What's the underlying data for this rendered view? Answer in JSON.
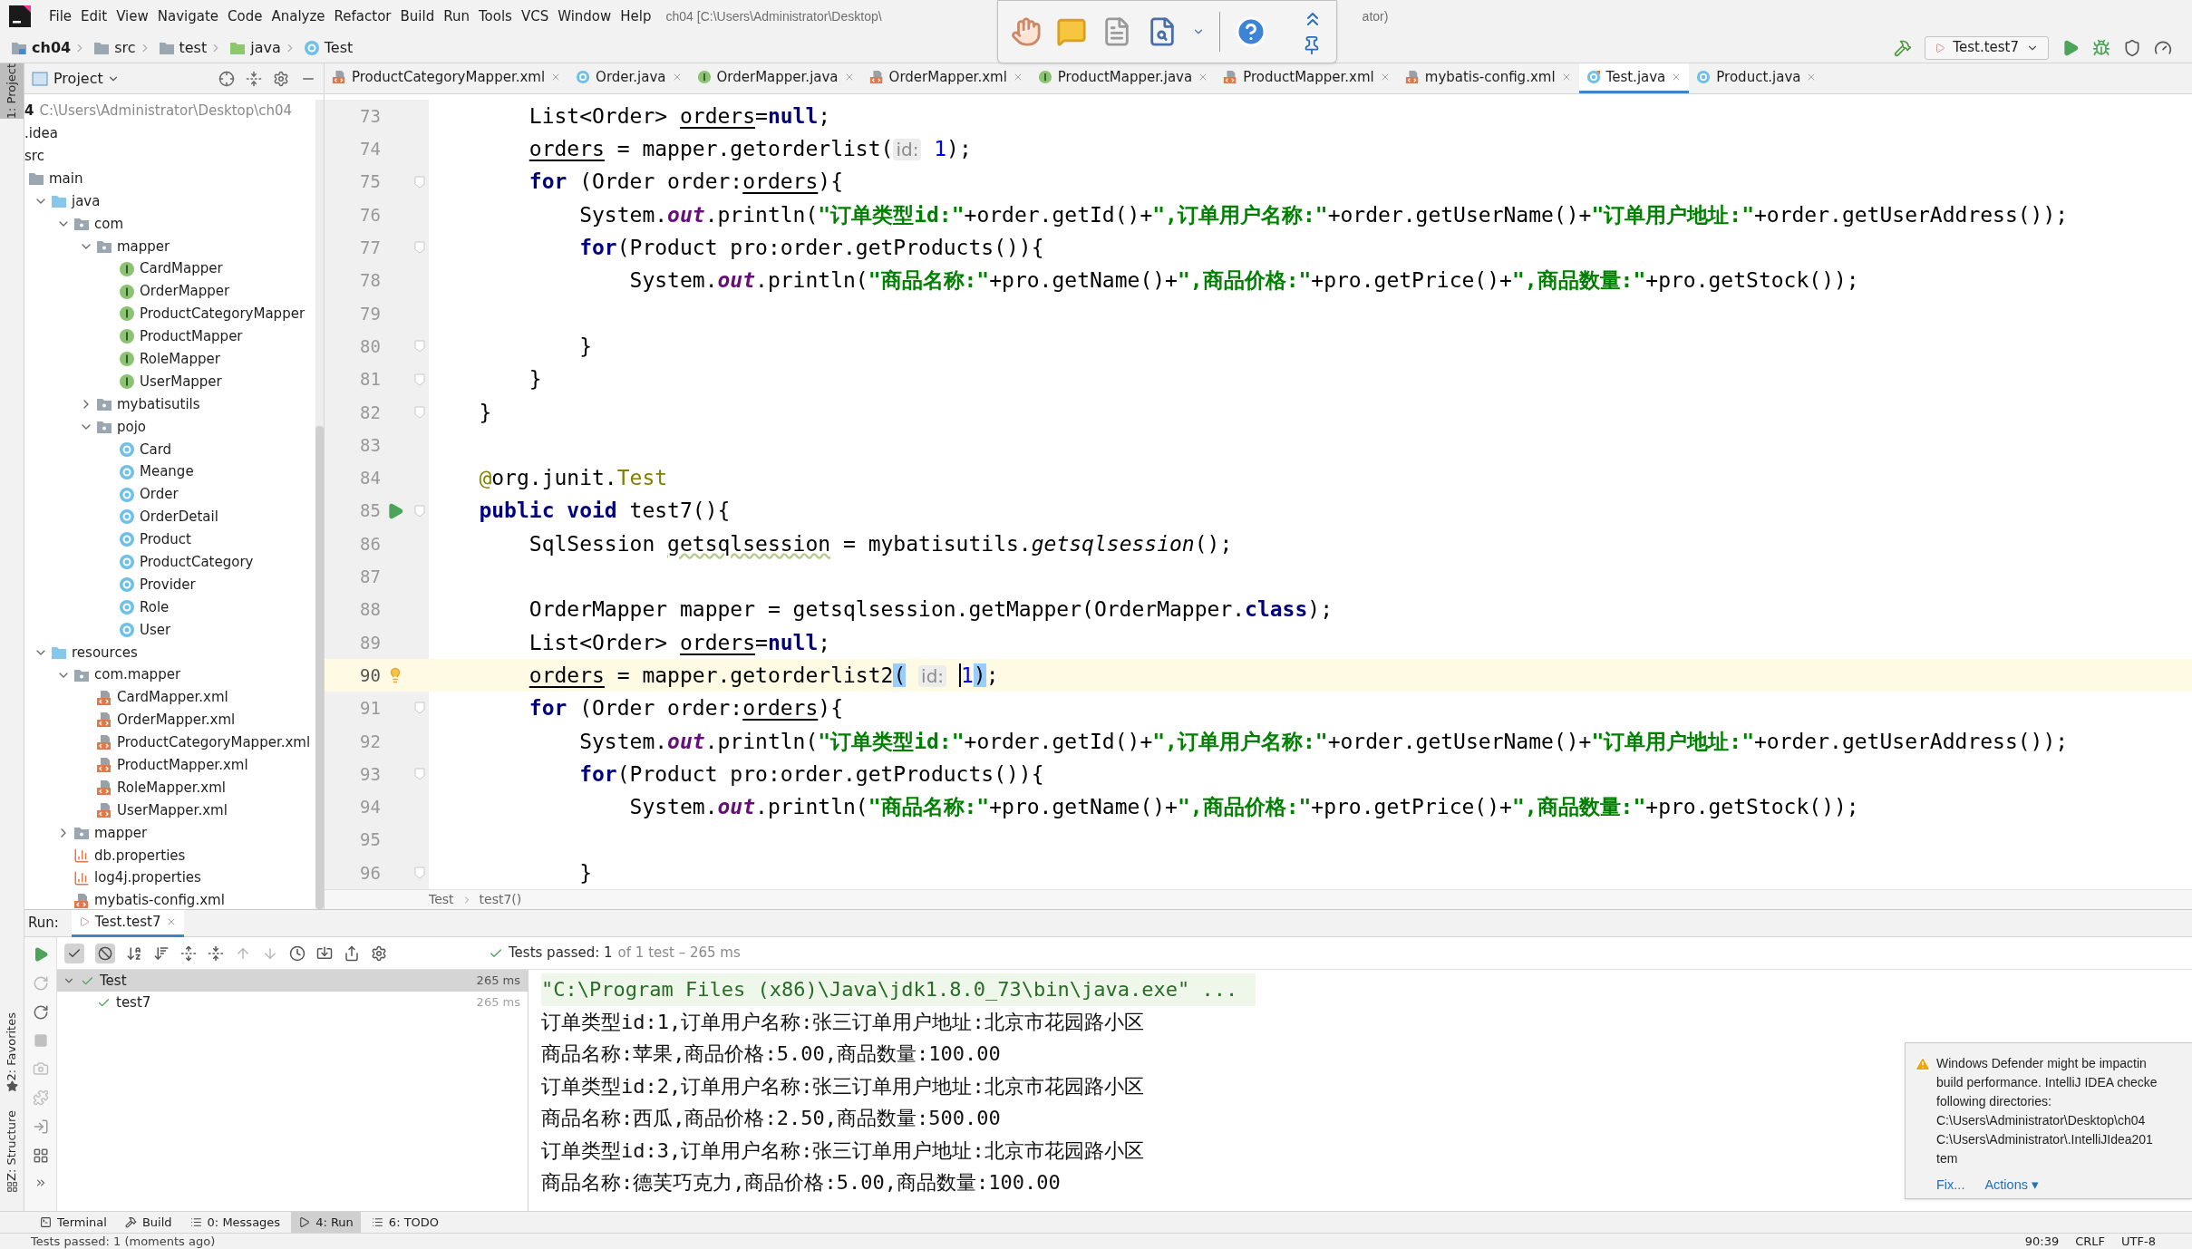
{
  "menu": [
    "File",
    "Edit",
    "View",
    "Navigate",
    "Code",
    "Analyze",
    "Refactor",
    "Build",
    "Run",
    "Tools",
    "VCS",
    "Window",
    "Help"
  ],
  "title_parts": [
    "ch04 [C:\\Users\\Administrator\\Desktop\\",
    "ator)"
  ],
  "navbar": [
    {
      "label": "ch04",
      "kind": "module"
    },
    {
      "label": "src",
      "kind": "folder"
    },
    {
      "label": "test",
      "kind": "folder"
    },
    {
      "label": "java",
      "kind": "test-folder"
    },
    {
      "label": "Test",
      "kind": "class"
    }
  ],
  "run_config": "Test.test7",
  "project_panel": {
    "title": "Project",
    "tree": [
      {
        "label": "4",
        "hint": "C:\\Users\\Administrator\\Desktop\\ch04",
        "kind": "cut",
        "children": [
          {
            "label": ".idea",
            "kind": "cut"
          },
          {
            "label": "src",
            "kind": "cut",
            "children": [
              {
                "label": "main",
                "kind": "folder",
                "children": [
                  {
                    "label": "java",
                    "kind": "source-folder",
                    "expanded": true,
                    "children": [
                      {
                        "label": "com",
                        "kind": "package",
                        "expanded": true,
                        "children": [
                          {
                            "label": "mapper",
                            "kind": "package",
                            "expanded": true,
                            "children": [
                              {
                                "label": "CardMapper",
                                "kind": "interface"
                              },
                              {
                                "label": "OrderMapper",
                                "kind": "interface"
                              },
                              {
                                "label": "ProductCategoryMapper",
                                "kind": "interface"
                              },
                              {
                                "label": "ProductMapper",
                                "kind": "interface"
                              },
                              {
                                "label": "RoleMapper",
                                "kind": "interface"
                              },
                              {
                                "label": "UserMapper",
                                "kind": "interface"
                              }
                            ]
                          },
                          {
                            "label": "mybatisutils",
                            "kind": "package",
                            "expanded": false
                          },
                          {
                            "label": "pojo",
                            "kind": "package",
                            "expanded": true,
                            "children": [
                              {
                                "label": "Card",
                                "kind": "class"
                              },
                              {
                                "label": "Meange",
                                "kind": "class"
                              },
                              {
                                "label": "Order",
                                "kind": "class"
                              },
                              {
                                "label": "OrderDetail",
                                "kind": "class"
                              },
                              {
                                "label": "Product",
                                "kind": "class"
                              },
                              {
                                "label": "ProductCategory",
                                "kind": "class"
                              },
                              {
                                "label": "Provider",
                                "kind": "class"
                              },
                              {
                                "label": "Role",
                                "kind": "class"
                              },
                              {
                                "label": "User",
                                "kind": "class"
                              }
                            ]
                          }
                        ]
                      }
                    ]
                  },
                  {
                    "label": "resources",
                    "kind": "source-folder",
                    "expanded": true,
                    "children": [
                      {
                        "label": "com.mapper",
                        "kind": "package",
                        "expanded": true,
                        "children": [
                          {
                            "label": "CardMapper.xml",
                            "kind": "xml"
                          },
                          {
                            "label": "OrderMapper.xml",
                            "kind": "xml"
                          },
                          {
                            "label": "ProductCategoryMapper.xml",
                            "kind": "xml"
                          },
                          {
                            "label": "ProductMapper.xml",
                            "kind": "xml"
                          },
                          {
                            "label": "RoleMapper.xml",
                            "kind": "xml"
                          },
                          {
                            "label": "UserMapper.xml",
                            "kind": "xml"
                          }
                        ]
                      },
                      {
                        "label": "mapper",
                        "kind": "package",
                        "expanded": false
                      },
                      {
                        "label": "db.properties",
                        "kind": "properties"
                      },
                      {
                        "label": "log4j.properties",
                        "kind": "properties"
                      },
                      {
                        "label": "mybatis-config.xml",
                        "kind": "xml"
                      }
                    ]
                  }
                ]
              }
            ]
          }
        ]
      }
    ]
  },
  "editor_tabs": [
    {
      "label": "ProductCategoryMapper.xml",
      "kind": "xml",
      "selected": false
    },
    {
      "label": "Order.java",
      "kind": "class",
      "selected": false
    },
    {
      "label": "OrderMapper.java",
      "kind": "interface",
      "selected": false
    },
    {
      "label": "OrderMapper.xml",
      "kind": "xml",
      "selected": false
    },
    {
      "label": "ProductMapper.java",
      "kind": "interface",
      "selected": false
    },
    {
      "label": "ProductMapper.xml",
      "kind": "xml",
      "selected": false
    },
    {
      "label": "mybatis-config.xml",
      "kind": "xml",
      "selected": false
    },
    {
      "label": "Test.java",
      "kind": "test-class",
      "selected": true
    },
    {
      "label": "Product.java",
      "kind": "class",
      "selected": false
    }
  ],
  "code_lines": [
    {
      "number": "73",
      "fold": false,
      "current": false,
      "runnable": false,
      "intention": false,
      "tokens": [
        {
          "kind": "plain",
          "text": "        List<Order> "
        },
        {
          "kind": "var",
          "text": "orders"
        },
        {
          "kind": "plain",
          "text": "="
        },
        {
          "kind": "keyword",
          "text": "null"
        },
        {
          "kind": "plain",
          "text": ";"
        }
      ]
    },
    {
      "number": "74",
      "fold": false,
      "current": false,
      "runnable": false,
      "intention": false,
      "tokens": [
        {
          "kind": "var",
          "text": "        orders"
        },
        {
          "kind": "plain",
          "text": " = mapper.getorderlist("
        },
        {
          "kind": "hint",
          "text": "id:"
        },
        {
          "kind": "number",
          "text": " 1"
        },
        {
          "kind": "plain",
          "text": ");"
        }
      ]
    },
    {
      "number": "75",
      "fold": true,
      "current": false,
      "runnable": false,
      "intention": false,
      "tokens": [
        {
          "kind": "keyword",
          "text": "        for"
        },
        {
          "kind": "plain",
          "text": " (Order order:"
        },
        {
          "kind": "var",
          "text": "orders"
        },
        {
          "kind": "plain",
          "text": "){"
        }
      ]
    },
    {
      "number": "76",
      "fold": false,
      "current": false,
      "runnable": false,
      "intention": false,
      "tokens": [
        {
          "kind": "plain",
          "text": "            System."
        },
        {
          "kind": "field",
          "text": "out"
        },
        {
          "kind": "plain",
          "text": ".println("
        },
        {
          "kind": "string",
          "text": "\"订单类型id:\""
        },
        {
          "kind": "plain",
          "text": "+order.getId()+"
        },
        {
          "kind": "string",
          "text": "\",订单用户名称:\""
        },
        {
          "kind": "plain",
          "text": "+order.getUserName()+"
        },
        {
          "kind": "string",
          "text": "\"订单用户地址:\""
        },
        {
          "kind": "plain",
          "text": "+order.getUserAddress());"
        }
      ]
    },
    {
      "number": "77",
      "fold": true,
      "current": false,
      "runnable": false,
      "intention": false,
      "tokens": [
        {
          "kind": "keyword",
          "text": "            for"
        },
        {
          "kind": "plain",
          "text": "(Product pro:order.getProducts()){"
        }
      ]
    },
    {
      "number": "78",
      "fold": false,
      "current": false,
      "runnable": false,
      "intention": false,
      "tokens": [
        {
          "kind": "plain",
          "text": "                System."
        },
        {
          "kind": "field",
          "text": "out"
        },
        {
          "kind": "plain",
          "text": ".println("
        },
        {
          "kind": "string",
          "text": "\"商品名称:\""
        },
        {
          "kind": "plain",
          "text": "+pro.getName()+"
        },
        {
          "kind": "string",
          "text": "\",商品价格:\""
        },
        {
          "kind": "plain",
          "text": "+pro.getPrice()+"
        },
        {
          "kind": "string",
          "text": "\",商品数量:\""
        },
        {
          "kind": "plain",
          "text": "+pro.getStock());"
        }
      ]
    },
    {
      "number": "79",
      "fold": false,
      "current": false,
      "runnable": false,
      "intention": false
    },
    {
      "number": "80",
      "fold": true,
      "current": false,
      "runnable": false,
      "intention": false,
      "tokens": [
        {
          "kind": "plain",
          "text": "            }"
        }
      ]
    },
    {
      "number": "81",
      "fold": true,
      "current": false,
      "runnable": false,
      "intention": false,
      "tokens": [
        {
          "kind": "plain",
          "text": "        }"
        }
      ]
    },
    {
      "number": "82",
      "fold": true,
      "current": false,
      "runnable": false,
      "intention": false,
      "tokens": [
        {
          "kind": "plain",
          "text": "    }"
        }
      ]
    },
    {
      "number": "83",
      "fold": false,
      "current": false,
      "runnable": false,
      "intention": false
    },
    {
      "number": "84",
      "fold": false,
      "current": false,
      "runnable": false,
      "intention": false,
      "tokens": [
        {
          "kind": "annotation",
          "text": "    @"
        },
        {
          "kind": "plain",
          "text": "org.junit."
        },
        {
          "kind": "annotation",
          "text": "Test"
        }
      ]
    },
    {
      "number": "85",
      "fold": true,
      "current": false,
      "runnable": true,
      "intention": false,
      "tokens": [
        {
          "kind": "keyword",
          "text": "    public void"
        },
        {
          "kind": "plain",
          "text": " test7(){"
        }
      ]
    },
    {
      "number": "86",
      "fold": false,
      "current": false,
      "runnable": false,
      "intention": false,
      "tokens": [
        {
          "kind": "plain",
          "text": "        SqlSession "
        },
        {
          "kind": "warn",
          "text": "getsqlsession"
        },
        {
          "kind": "plain",
          "text": " = mybatisutils."
        },
        {
          "kind": "static",
          "text": "getsqlsession"
        },
        {
          "kind": "plain",
          "text": "();"
        }
      ]
    },
    {
      "number": "87",
      "fold": false,
      "current": false,
      "runnable": false,
      "intention": false
    },
    {
      "number": "88",
      "fold": false,
      "current": false,
      "runnable": false,
      "intention": false,
      "tokens": [
        {
          "kind": "plain",
          "text": "        OrderMapper mapper = getsqlsession.getMapper(OrderMapper."
        },
        {
          "kind": "keyword",
          "text": "class"
        },
        {
          "kind": "plain",
          "text": ");"
        }
      ]
    },
    {
      "number": "89",
      "fold": false,
      "current": false,
      "runnable": false,
      "intention": false,
      "tokens": [
        {
          "kind": "plain",
          "text": "        List<Order> "
        },
        {
          "kind": "var",
          "text": "orders"
        },
        {
          "kind": "plain",
          "text": "="
        },
        {
          "kind": "keyword",
          "text": "null"
        },
        {
          "kind": "plain",
          "text": ";"
        }
      ]
    },
    {
      "number": "90",
      "fold": false,
      "current": true,
      "runnable": false,
      "intention": true,
      "tokens": [
        {
          "kind": "var",
          "text": "        orders"
        },
        {
          "kind": "plain",
          "text": " = mapper.getorderlist2"
        },
        {
          "kind": "match",
          "text": "("
        },
        {
          "kind": "hint",
          "text": " id:"
        },
        {
          "kind": "caret",
          "text": " 1"
        },
        {
          "kind": "match",
          "text": ")"
        },
        {
          "kind": "plain",
          "text": ";"
        }
      ]
    },
    {
      "number": "91",
      "fold": true,
      "current": false,
      "runnable": false,
      "intention": false,
      "tokens": [
        {
          "kind": "keyword",
          "text": "        for"
        },
        {
          "kind": "plain",
          "text": " (Order order:"
        },
        {
          "kind": "var",
          "text": "orders"
        },
        {
          "kind": "plain",
          "text": "){"
        }
      ]
    },
    {
      "number": "92",
      "fold": false,
      "current": false,
      "runnable": false,
      "intention": false,
      "tokens": [
        {
          "kind": "plain",
          "text": "            System."
        },
        {
          "kind": "field",
          "text": "out"
        },
        {
          "kind": "plain",
          "text": ".println("
        },
        {
          "kind": "string",
          "text": "\"订单类型id:\""
        },
        {
          "kind": "plain",
          "text": "+order.getId()+"
        },
        {
          "kind": "string",
          "text": "\",订单用户名称:\""
        },
        {
          "kind": "plain",
          "text": "+order.getUserName()+"
        },
        {
          "kind": "string",
          "text": "\"订单用户地址:\""
        },
        {
          "kind": "plain",
          "text": "+order.getUserAddress());"
        }
      ]
    },
    {
      "number": "93",
      "fold": true,
      "current": false,
      "runnable": false,
      "intention": false,
      "tokens": [
        {
          "kind": "keyword",
          "text": "            for"
        },
        {
          "kind": "plain",
          "text": "(Product pro:order.getProducts()){"
        }
      ]
    },
    {
      "number": "94",
      "fold": false,
      "current": false,
      "runnable": false,
      "intention": false,
      "tokens": [
        {
          "kind": "plain",
          "text": "                System."
        },
        {
          "kind": "field",
          "text": "out"
        },
        {
          "kind": "plain",
          "text": ".println("
        },
        {
          "kind": "string",
          "text": "\"商品名称:\""
        },
        {
          "kind": "plain",
          "text": "+pro.getName()+"
        },
        {
          "kind": "string",
          "text": "\",商品价格:\""
        },
        {
          "kind": "plain",
          "text": "+pro.getPrice()+"
        },
        {
          "kind": "string",
          "text": "\",商品数量:\""
        },
        {
          "kind": "plain",
          "text": "+pro.getStock());"
        }
      ]
    },
    {
      "number": "95",
      "fold": false,
      "current": false,
      "runnable": false,
      "intention": false
    },
    {
      "number": "96",
      "fold": true,
      "current": false,
      "runnable": false,
      "intention": false,
      "tokens": [
        {
          "kind": "plain",
          "text": "            }"
        }
      ]
    }
  ],
  "editor_breadcrumbs": [
    "Test",
    "test7()"
  ],
  "run_panel": {
    "label": "Run:",
    "tab": "Test.test7",
    "status_main": "Tests passed: 1",
    "status_rest": "of 1 test – 265 ms",
    "tests": [
      {
        "name": "Test",
        "time": "265 ms",
        "selected": true,
        "children": [
          {
            "name": "test7",
            "time": "265 ms",
            "selected": false
          }
        ]
      }
    ],
    "console": [
      {
        "kind": "command",
        "text": "\"C:\\Program Files (x86)\\Java\\jdk1.8.0_73\\bin\\java.exe\" ..."
      },
      {
        "kind": "output",
        "text": "订单类型id:1,订单用户名称:张三订单用户地址:北京市花园路小区"
      },
      {
        "kind": "output",
        "text": "商品名称:苹果,商品价格:5.00,商品数量:100.00"
      },
      {
        "kind": "output",
        "text": "订单类型id:2,订单用户名称:张三订单用户地址:北京市花园路小区"
      },
      {
        "kind": "output",
        "text": "商品名称:西瓜,商品价格:2.50,商品数量:500.00"
      },
      {
        "kind": "output",
        "text": "订单类型id:3,订单用户名称:张三订单用户地址:北京市花园路小区"
      },
      {
        "kind": "output",
        "text": "商品名称:德芙巧克力,商品价格:5.00,商品数量:100.00"
      }
    ]
  },
  "side_stripe": {
    "top": "1: Project",
    "bottom": [
      "2: Favorites",
      "Z: Structure"
    ]
  },
  "tool_tabs": [
    {
      "label": "Terminal",
      "kind": "terminal",
      "selected": false
    },
    {
      "label": "Build",
      "kind": "build",
      "selected": false
    },
    {
      "label": "0: Messages",
      "kind": "messages",
      "selected": false
    },
    {
      "label": "4: Run",
      "kind": "run",
      "selected": true
    },
    {
      "label": "6: TODO",
      "kind": "todo",
      "selected": false
    }
  ],
  "notification": {
    "lines": [
      "Windows Defender might be impactin",
      "build performance. IntelliJ IDEA checke",
      "following directories:",
      "C:\\Users\\Administrator\\Desktop\\ch04",
      "C:\\Users\\Administrator\\.IntelliJIdea201",
      "tem"
    ],
    "links": [
      "Fix...",
      "Actions ▾"
    ]
  },
  "status_bar": {
    "message": "Tests passed: 1 (moments ago)",
    "position": "90:39",
    "line_separator": "CRLF",
    "encoding": "UTF-8"
  }
}
